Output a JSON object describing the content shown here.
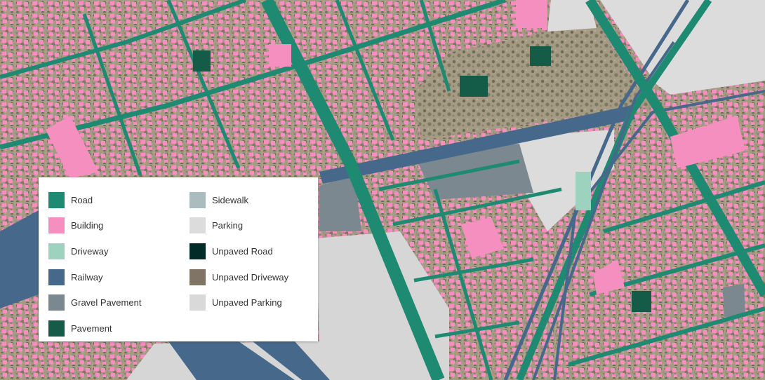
{
  "legend": {
    "left_column": [
      {
        "label": "Road",
        "color": "#1e8a72"
      },
      {
        "label": "Building",
        "color": "#f58fbf"
      },
      {
        "label": "Driveway",
        "color": "#9dd2be"
      },
      {
        "label": "Railway",
        "color": "#46688a"
      },
      {
        "label": "Gravel Pavement",
        "color": "#7b8890"
      },
      {
        "label": "Pavement",
        "color": "#145c48"
      }
    ],
    "right_column": [
      {
        "label": "Sidewalk",
        "color": "#aabcbd"
      },
      {
        "label": "Parking",
        "color": "#dcdcdc"
      },
      {
        "label": "Unpaved Road",
        "color": "#022b27"
      },
      {
        "label": "Unpaved Driveway",
        "color": "#7f7466"
      },
      {
        "label": "Unpaved Parking",
        "color": "#d9d9d9"
      }
    ]
  }
}
